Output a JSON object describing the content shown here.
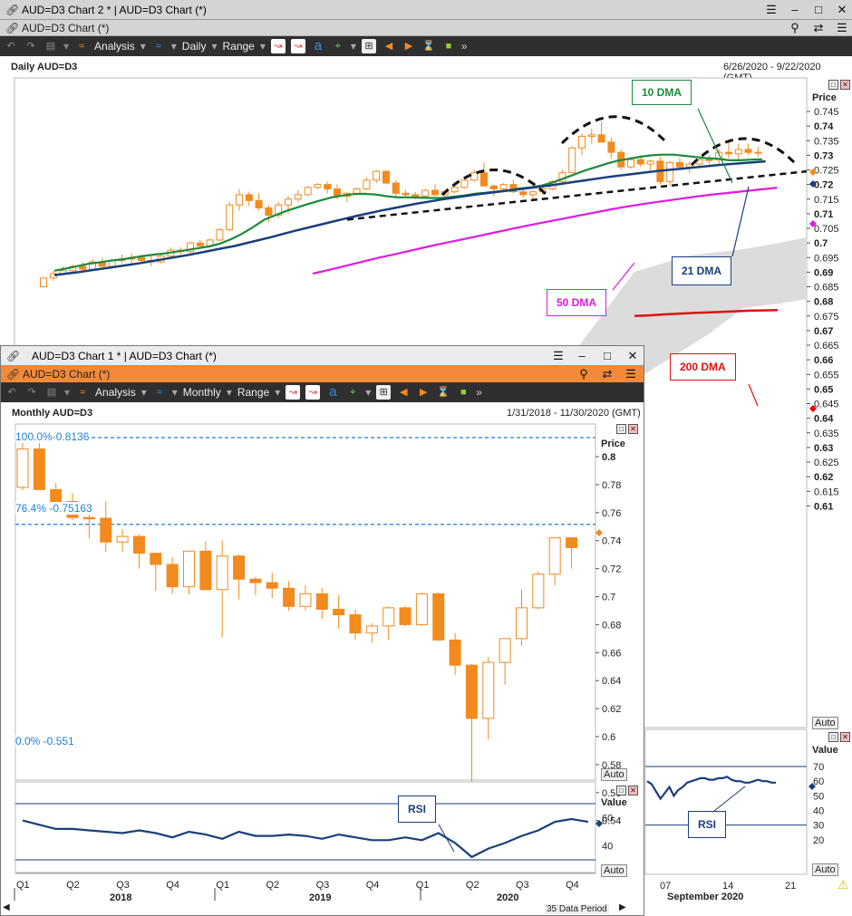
{
  "win2": {
    "title": "AUD=D3 Chart 2 * | AUD=D3 Chart (*)",
    "subtitle": "AUD=D3 Chart (*)",
    "chart_label": "Daily AUD=D3",
    "date_range": "6/26/2020 - 9/22/2020 (GMT)",
    "toolbar": {
      "analysis": "Analysis",
      "period": "Daily",
      "range": "Range"
    },
    "price_label": "Price",
    "value_label": "Value",
    "auto": "Auto",
    "annotations": {
      "dma10": "10 DMA",
      "dma21": "21 DMA",
      "dma50": "50 DMA",
      "dma200": "200 DMA",
      "rsi": "RSI"
    },
    "x_labels": [
      "07",
      "14",
      "21"
    ],
    "x_month": "September 2020"
  },
  "win1": {
    "title": "AUD=D3 Chart 1 * | AUD=D3 Chart (*)",
    "subtitle": "AUD=D3 Chart (*)",
    "chart_label": "Monthly AUD=D3",
    "date_range": "1/31/2018 - 11/30/2020 (GMT)",
    "toolbar": {
      "analysis": "Analysis",
      "period": "Monthly",
      "range": "Range"
    },
    "price_label": "Price",
    "value_label": "Value",
    "auto": "Auto",
    "rsi": "RSI",
    "fib": {
      "f100": "100.0%-0.8136",
      "f764": "76.4% -0.75163",
      "f0": "0.0% -0.551"
    },
    "quarters": [
      "Q1",
      "Q2",
      "Q3",
      "Q4",
      "Q1",
      "Q2",
      "Q3",
      "Q4",
      "Q1",
      "Q2",
      "Q3",
      "Q4"
    ],
    "years": [
      "2018",
      "2019",
      "2020"
    ],
    "data_period": "35 Data Period"
  },
  "colors": {
    "orange": "#f28a1e",
    "dma10": "#1b8a3c",
    "dma21": "#1a3f7a",
    "dma50": "#e01adf",
    "dma200": "#e01010",
    "fib": "#1f7fd8"
  },
  "chart_data": [
    {
      "type": "candlestick",
      "title": "Daily AUD=D3",
      "ylim": [
        0.605,
        0.75
      ],
      "yticks": [
        0.745,
        0.74,
        0.735,
        0.73,
        0.725,
        0.72,
        0.715,
        0.71,
        0.705,
        0.7,
        0.695,
        0.69,
        0.685,
        0.68,
        0.675,
        0.67,
        0.665,
        0.66,
        0.655,
        0.65,
        0.645,
        0.64,
        0.635,
        0.63,
        0.625,
        0.62,
        0.615,
        0.61
      ],
      "candles": [
        [
          0.685,
          0.688,
          0.685,
          0.688
        ],
        [
          0.688,
          0.6905,
          0.687,
          0.6895
        ],
        [
          0.6895,
          0.692,
          0.689,
          0.6905
        ],
        [
          0.6905,
          0.6925,
          0.6895,
          0.692
        ],
        [
          0.692,
          0.6935,
          0.69,
          0.691
        ],
        [
          0.691,
          0.6945,
          0.6905,
          0.6935
        ],
        [
          0.6935,
          0.695,
          0.6915,
          0.692
        ],
        [
          0.692,
          0.6945,
          0.6915,
          0.694
        ],
        [
          0.694,
          0.696,
          0.693,
          0.6945
        ],
        [
          0.6945,
          0.6965,
          0.693,
          0.695
        ],
        [
          0.695,
          0.696,
          0.6935,
          0.694
        ],
        [
          0.694,
          0.6955,
          0.692,
          0.6935
        ],
        [
          0.6935,
          0.696,
          0.693,
          0.6955
        ],
        [
          0.6955,
          0.6985,
          0.695,
          0.6975
        ],
        [
          0.6975,
          0.6985,
          0.696,
          0.697
        ],
        [
          0.697,
          0.7005,
          0.6965,
          0.7
        ],
        [
          0.7,
          0.701,
          0.698,
          0.699
        ],
        [
          0.699,
          0.7015,
          0.6985,
          0.701
        ],
        [
          0.701,
          0.705,
          0.7005,
          0.7045
        ],
        [
          0.7045,
          0.714,
          0.704,
          0.713
        ],
        [
          0.713,
          0.7185,
          0.711,
          0.7165
        ],
        [
          0.7165,
          0.7175,
          0.7125,
          0.7145
        ],
        [
          0.7145,
          0.717,
          0.711,
          0.712
        ],
        [
          0.712,
          0.713,
          0.707,
          0.7095
        ],
        [
          0.7095,
          0.714,
          0.7085,
          0.713
        ],
        [
          0.713,
          0.716,
          0.71,
          0.715
        ],
        [
          0.715,
          0.718,
          0.714,
          0.7165
        ],
        [
          0.7165,
          0.7195,
          0.716,
          0.719
        ],
        [
          0.719,
          0.7205,
          0.7185,
          0.72
        ],
        [
          0.72,
          0.721,
          0.717,
          0.7185
        ],
        [
          0.7185,
          0.72,
          0.715,
          0.716
        ],
        [
          0.716,
          0.7175,
          0.714,
          0.717
        ],
        [
          0.717,
          0.719,
          0.7165,
          0.7185
        ],
        [
          0.7185,
          0.7225,
          0.718,
          0.7215
        ],
        [
          0.7215,
          0.725,
          0.7205,
          0.7245
        ],
        [
          0.7245,
          0.725,
          0.72,
          0.7205
        ],
        [
          0.7205,
          0.7215,
          0.716,
          0.717
        ],
        [
          0.717,
          0.718,
          0.7155,
          0.7165
        ],
        [
          0.7165,
          0.7175,
          0.715,
          0.716
        ],
        [
          0.716,
          0.7185,
          0.7155,
          0.718
        ],
        [
          0.718,
          0.72,
          0.716,
          0.7165
        ],
        [
          0.7165,
          0.718,
          0.716,
          0.7175
        ],
        [
          0.7175,
          0.7195,
          0.717,
          0.719
        ],
        [
          0.719,
          0.7225,
          0.7185,
          0.7215
        ],
        [
          0.7215,
          0.725,
          0.721,
          0.724
        ],
        [
          0.724,
          0.7275,
          0.722,
          0.7195
        ],
        [
          0.7195,
          0.72,
          0.716,
          0.7185
        ],
        [
          0.7185,
          0.7205,
          0.7175,
          0.72
        ],
        [
          0.72,
          0.7215,
          0.717,
          0.7175
        ],
        [
          0.7175,
          0.719,
          0.7155,
          0.7165
        ],
        [
          0.7165,
          0.718,
          0.715,
          0.7175
        ],
        [
          0.7175,
          0.719,
          0.7165,
          0.7185
        ],
        [
          0.7185,
          0.7215,
          0.718,
          0.721
        ],
        [
          0.721,
          0.725,
          0.7205,
          0.724
        ],
        [
          0.724,
          0.733,
          0.724,
          0.7325
        ],
        [
          0.7325,
          0.7375,
          0.73,
          0.7365
        ],
        [
          0.7365,
          0.739,
          0.734,
          0.737
        ],
        [
          0.737,
          0.7415,
          0.7345,
          0.7345
        ],
        [
          0.7345,
          0.736,
          0.729,
          0.731
        ],
        [
          0.731,
          0.732,
          0.725,
          0.726
        ],
        [
          0.726,
          0.7295,
          0.7255,
          0.7285
        ],
        [
          0.7285,
          0.73,
          0.726,
          0.727
        ],
        [
          0.727,
          0.7285,
          0.725,
          0.728
        ],
        [
          0.728,
          0.7295,
          0.72,
          0.721
        ],
        [
          0.721,
          0.728,
          0.7195,
          0.7275
        ],
        [
          0.7275,
          0.729,
          0.725,
          0.726
        ],
        [
          0.726,
          0.728,
          0.724,
          0.727
        ],
        [
          0.727,
          0.729,
          0.7265,
          0.7285
        ],
        [
          0.7285,
          0.73,
          0.727,
          0.7285
        ],
        [
          0.7285,
          0.732,
          0.727,
          0.731
        ],
        [
          0.731,
          0.7345,
          0.729,
          0.7305
        ],
        [
          0.7305,
          0.734,
          0.728,
          0.732
        ],
        [
          0.732,
          0.734,
          0.73,
          0.731
        ],
        [
          0.731,
          0.733,
          0.7295,
          0.731
        ]
      ],
      "series": [
        {
          "name": "10 DMA",
          "values": [
            0.6905,
            0.6912,
            0.692,
            0.6928,
            0.6933,
            0.6939,
            0.6943,
            0.6949,
            0.6955,
            0.696,
            0.6964,
            0.697,
            0.6976,
            0.6982,
            0.6988,
            0.6998,
            0.7013,
            0.7032,
            0.7055,
            0.708,
            0.7095,
            0.711,
            0.7122,
            0.7134,
            0.7145,
            0.7155,
            0.7162,
            0.7167,
            0.7168,
            0.7166,
            0.716,
            0.7156,
            0.7156,
            0.7155,
            0.7154,
            0.7154,
            0.7158,
            0.7162,
            0.7168,
            0.7172,
            0.7176,
            0.718,
            0.7186,
            0.719,
            0.7196,
            0.7206,
            0.722,
            0.7234,
            0.7248,
            0.726,
            0.7272,
            0.7282,
            0.7288,
            0.7295,
            0.73,
            0.7302,
            0.7302,
            0.7298,
            0.7294,
            0.729,
            0.7288,
            0.7283,
            0.7283,
            0.7285,
            0.7286
          ]
        },
        {
          "name": "21 DMA",
          "values": [
            0.689,
            0.6895,
            0.69,
            0.6906,
            0.6912,
            0.6918,
            0.6924,
            0.693,
            0.6937,
            0.6944,
            0.6951,
            0.6958,
            0.6966,
            0.6974,
            0.6982,
            0.699,
            0.7,
            0.701,
            0.702,
            0.7031,
            0.7042,
            0.7052,
            0.7062,
            0.7072,
            0.7082,
            0.7092,
            0.7101,
            0.711,
            0.7118,
            0.7126,
            0.7134,
            0.7141,
            0.7148,
            0.7154,
            0.716,
            0.7166,
            0.7171,
            0.7176,
            0.7181,
            0.7186,
            0.7191,
            0.7196,
            0.7202,
            0.7208,
            0.7214,
            0.722,
            0.7226,
            0.7231,
            0.7236,
            0.7241,
            0.7246,
            0.725,
            0.7254,
            0.7258,
            0.7262,
            0.7266,
            0.727,
            0.7273,
            0.7276,
            0.7279
          ]
        },
        {
          "name": "50 DMA",
          "values": [
            0.6895,
            0.6908,
            0.6922,
            0.6936,
            0.695,
            0.6962,
            0.6975,
            0.6988,
            0.7,
            0.7012,
            0.7024,
            0.7036,
            0.7048,
            0.706,
            0.7071,
            0.7082,
            0.7093,
            0.7104,
            0.7115,
            0.7125,
            0.7134,
            0.7142,
            0.715,
            0.7158,
            0.7165,
            0.7171,
            0.7177,
            0.7183,
            0.7189
          ]
        },
        {
          "name": "200 DMA",
          "values": [
            0.675,
            0.6752,
            0.6755,
            0.6758,
            0.676,
            0.6762,
            0.6764,
            0.6766,
            0.6768,
            0.6769,
            0.677
          ]
        }
      ],
      "current_price": 0.731,
      "rsi": {
        "ylim": [
          17,
          73
        ],
        "yticks": [
          70,
          60,
          50,
          40,
          30,
          20
        ],
        "bands": [
          70,
          30
        ],
        "values": [
          60,
          58,
          53,
          48,
          52,
          56,
          50,
          54,
          56,
          59,
          60,
          61,
          62,
          62,
          61,
          61,
          62,
          62,
          63,
          61,
          60,
          60,
          59,
          59,
          60,
          61,
          60,
          60,
          59,
          59
        ]
      },
      "x_labels": [
        "07",
        "14",
        "21"
      ],
      "x_month": "September 2020"
    },
    {
      "type": "candlestick",
      "title": "Monthly AUD=D3",
      "ylim": [
        0.525,
        0.815
      ],
      "yticks": [
        0.8,
        0.78,
        0.76,
        0.74,
        0.72,
        0.7,
        0.68,
        0.66,
        0.64,
        0.62,
        0.6,
        0.58,
        0.56,
        0.54
      ],
      "candles": [
        [
          0.778,
          0.8136,
          0.776,
          0.8055
        ],
        [
          0.8055,
          0.811,
          0.7775,
          0.7765
        ],
        [
          0.7765,
          0.781,
          0.764,
          0.768
        ],
        [
          0.768,
          0.774,
          0.7545,
          0.7565
        ],
        [
          0.7565,
          0.762,
          0.7415,
          0.756
        ],
        [
          0.756,
          0.768,
          0.732,
          0.739
        ],
        [
          0.739,
          0.748,
          0.732,
          0.743
        ],
        [
          0.743,
          0.7445,
          0.72,
          0.731
        ],
        [
          0.731,
          0.731,
          0.704,
          0.723
        ],
        [
          0.723,
          0.728,
          0.702,
          0.707
        ],
        [
          0.707,
          0.724,
          0.7015,
          0.7325
        ],
        [
          0.7325,
          0.7395,
          0.709,
          0.705
        ],
        [
          0.705,
          0.74,
          0.671,
          0.729
        ],
        [
          0.729,
          0.73,
          0.698,
          0.7125
        ],
        [
          0.7125,
          0.714,
          0.701,
          0.71
        ],
        [
          0.71,
          0.717,
          0.699,
          0.706
        ],
        [
          0.706,
          0.711,
          0.69,
          0.693
        ],
        [
          0.693,
          0.708,
          0.69,
          0.702
        ],
        [
          0.702,
          0.706,
          0.684,
          0.691
        ],
        [
          0.691,
          0.701,
          0.677,
          0.687
        ],
        [
          0.687,
          0.691,
          0.669,
          0.674
        ],
        [
          0.674,
          0.681,
          0.667,
          0.679
        ],
        [
          0.679,
          0.693,
          0.669,
          0.692
        ],
        [
          0.692,
          0.693,
          0.679,
          0.68
        ],
        [
          0.68,
          0.703,
          0.679,
          0.702
        ],
        [
          0.702,
          0.703,
          0.67,
          0.669
        ],
        [
          0.669,
          0.674,
          0.644,
          0.651
        ],
        [
          0.651,
          0.652,
          0.551,
          0.613
        ],
        [
          0.613,
          0.657,
          0.598,
          0.653
        ],
        [
          0.653,
          0.67,
          0.637,
          0.67
        ],
        [
          0.67,
          0.705,
          0.665,
          0.692
        ],
        [
          0.692,
          0.718,
          0.691,
          0.716
        ],
        [
          0.716,
          0.741,
          0.708,
          0.742
        ],
        [
          0.742,
          0.742,
          0.72,
          0.735
        ]
      ],
      "current_price": 0.731,
      "fibonacci": [
        {
          "label": "100.0%-0.8136",
          "value": 0.8136
        },
        {
          "label": "76.4% -0.75163",
          "value": 0.75163
        },
        {
          "label": "0.0% -0.551",
          "value": 0.551
        }
      ],
      "rsi": {
        "ylim": [
          27,
          72
        ],
        "yticks": [
          60,
          40
        ],
        "bands": [
          70,
          30
        ],
        "values": [
          58,
          55,
          52,
          52,
          51,
          50,
          49,
          51,
          49,
          46,
          50,
          48,
          45,
          50,
          47,
          47,
          48,
          47,
          45,
          48,
          46,
          44,
          44,
          46,
          44,
          49,
          42,
          32,
          38,
          42,
          47,
          51,
          57,
          59,
          57
        ]
      },
      "x_labels": [
        "Q1",
        "Q2",
        "Q3",
        "Q4",
        "Q1",
        "Q2",
        "Q3",
        "Q4",
        "Q1",
        "Q2",
        "Q3",
        "Q4"
      ],
      "x_years": [
        "2018",
        "2019",
        "2020"
      ]
    }
  ]
}
